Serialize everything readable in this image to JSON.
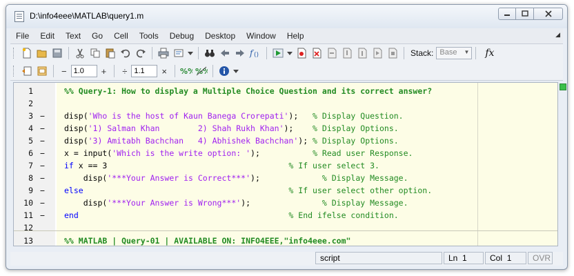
{
  "window": {
    "title": "D:\\info4eee\\MATLAB\\query1.m"
  },
  "menu": [
    "File",
    "Edit",
    "Text",
    "Go",
    "Cell",
    "Tools",
    "Debug",
    "Desktop",
    "Window",
    "Help"
  ],
  "toolbar": {
    "stack_label": "Stack:",
    "stack_value": "Base",
    "fx_label": "fx"
  },
  "cell_toolbar": {
    "minus": "−",
    "value1": "1.0",
    "plus": "+",
    "divide": "÷",
    "value2": "1.1",
    "times": "×"
  },
  "editor": {
    "lines": [
      {
        "n": "1",
        "m": "",
        "segs": [
          [
            "c-com c-bold",
            "%% Query-1: How to display a Multiple Choice Question and its correct answer?"
          ]
        ]
      },
      {
        "n": "2",
        "m": "",
        "segs": []
      },
      {
        "n": "3",
        "m": "−",
        "segs": [
          [
            "c-txt",
            "disp("
          ],
          [
            "c-str",
            "'Who is the host of Kaun Banega Crorepati'"
          ],
          [
            "c-txt",
            ");   "
          ],
          [
            "c-com",
            "% Display Question."
          ]
        ]
      },
      {
        "n": "4",
        "m": "−",
        "segs": [
          [
            "c-txt",
            "disp("
          ],
          [
            "c-str",
            "'1) Salman Khan        2) Shah Rukh Khan'"
          ],
          [
            "c-txt",
            ");    "
          ],
          [
            "c-com",
            "% Display Options."
          ]
        ]
      },
      {
        "n": "5",
        "m": "−",
        "segs": [
          [
            "c-txt",
            "disp("
          ],
          [
            "c-str",
            "'3) Amitabh Bachchan   4) Abhishek Bachchan'"
          ],
          [
            "c-txt",
            "); "
          ],
          [
            "c-com",
            "% Display Options."
          ]
        ]
      },
      {
        "n": "6",
        "m": "−",
        "segs": [
          [
            "c-txt",
            "x = input("
          ],
          [
            "c-str",
            "'Which is the write option: '"
          ],
          [
            "c-txt",
            ");           "
          ],
          [
            "c-com",
            "% Read user Response."
          ]
        ]
      },
      {
        "n": "7",
        "m": "−",
        "segs": [
          [
            "c-kw",
            "if"
          ],
          [
            "c-txt",
            " x == 3                                      "
          ],
          [
            "c-com",
            "% If user select 3."
          ]
        ]
      },
      {
        "n": "8",
        "m": "−",
        "segs": [
          [
            "c-txt",
            "    disp("
          ],
          [
            "c-str",
            "'***Your Answer is Correct***'"
          ],
          [
            "c-txt",
            ");             "
          ],
          [
            "c-com",
            "% Display Message."
          ]
        ]
      },
      {
        "n": "9",
        "m": "−",
        "segs": [
          [
            "c-kw",
            "else"
          ],
          [
            "c-txt",
            "                                           "
          ],
          [
            "c-com",
            "% If user select other option."
          ]
        ]
      },
      {
        "n": "10",
        "m": "−",
        "segs": [
          [
            "c-txt",
            "    disp("
          ],
          [
            "c-str",
            "'***Your Answer is Wrong***'"
          ],
          [
            "c-txt",
            ");               "
          ],
          [
            "c-com",
            "% Display Message."
          ]
        ]
      },
      {
        "n": "11",
        "m": "−",
        "segs": [
          [
            "c-kw",
            "end"
          ],
          [
            "c-txt",
            "                                            "
          ],
          [
            "c-com",
            "% End ifelse condition."
          ]
        ]
      },
      {
        "n": "12",
        "m": "",
        "segs": []
      },
      {
        "n": "13",
        "m": "",
        "segs": [
          [
            "c-com c-bold",
            "%% MATLAB | Query-01 | AVAILABLE ON: INFO4EEE,\"info4eee.com\""
          ]
        ]
      }
    ]
  },
  "status": {
    "mode": "script",
    "ln_label": "Ln",
    "ln_value": "1",
    "col_label": "Col",
    "col_value": "1",
    "ovr": "OVR"
  }
}
